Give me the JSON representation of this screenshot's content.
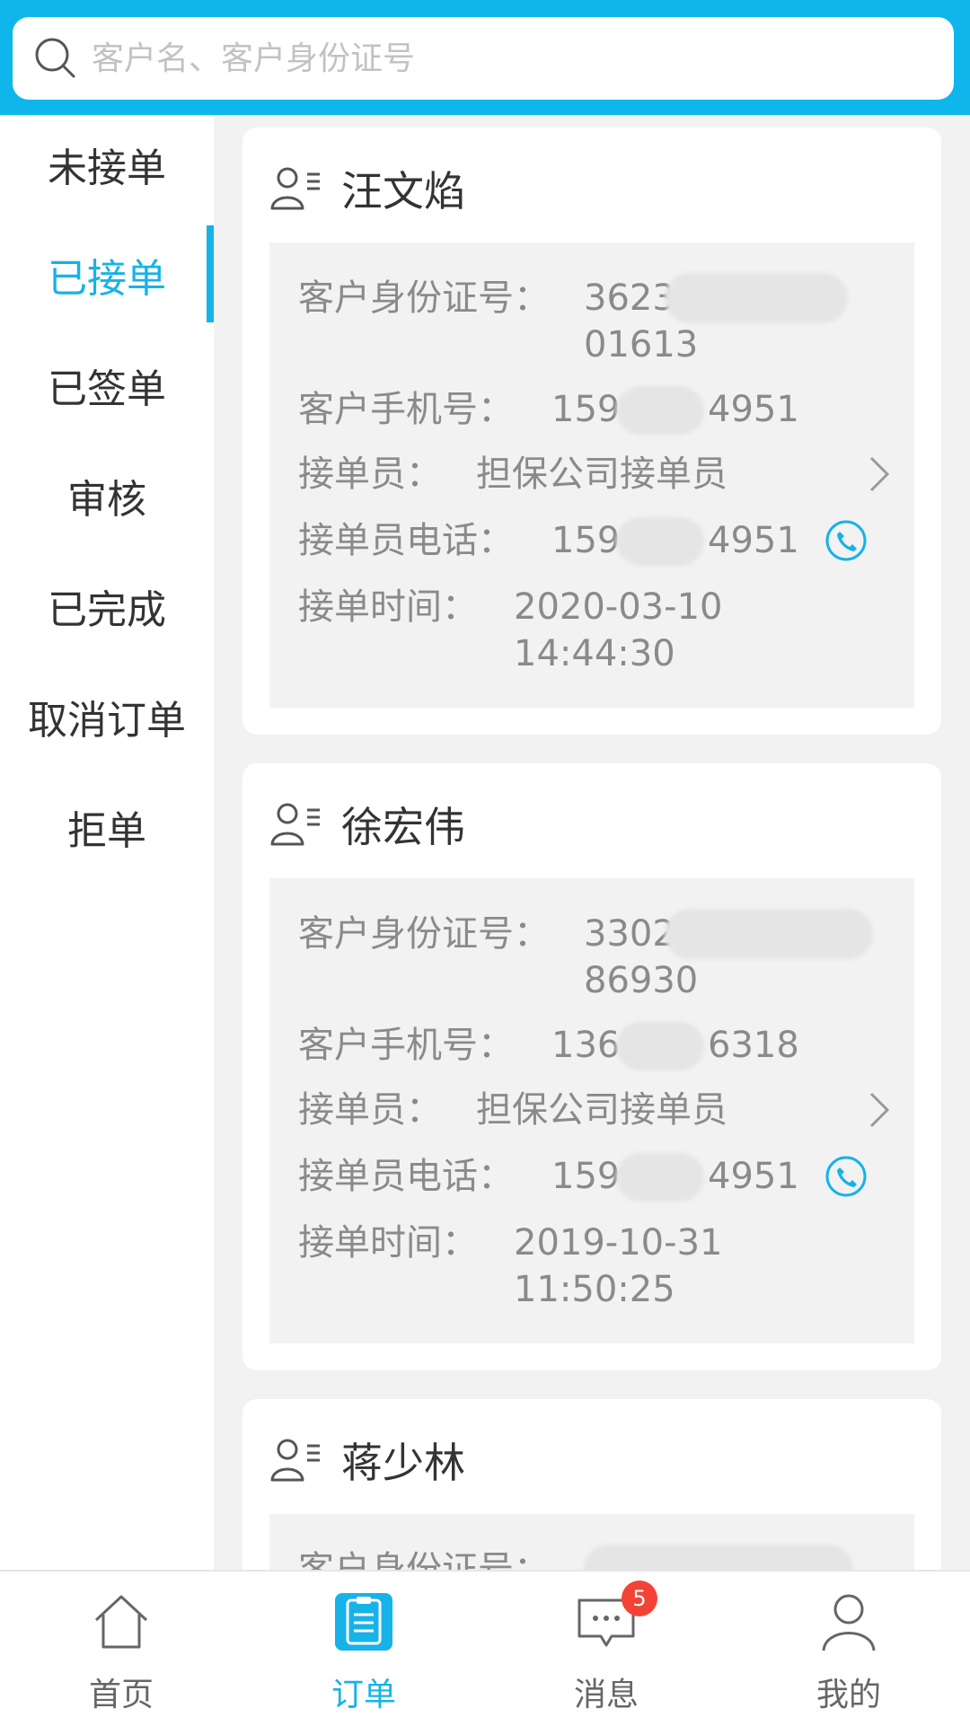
{
  "search": {
    "placeholder": "客户名、客户身份证号"
  },
  "sidebar": {
    "items": [
      {
        "label": "未接单"
      },
      {
        "label": "已接单"
      },
      {
        "label": "已签单"
      },
      {
        "label": "审核"
      },
      {
        "label": "已完成"
      },
      {
        "label": "取消订单"
      },
      {
        "label": "拒单"
      }
    ],
    "active_index": 1
  },
  "labels": {
    "id": "客户身份证号：",
    "mobile": "客户手机号：",
    "agent": "接单员：",
    "agent_phone": "接单员电话：",
    "time": "接单时间："
  },
  "orders": [
    {
      "name": "汪文焰",
      "id_line1": "3623",
      "id_line2": "01613",
      "mobile_prefix": "159",
      "mobile_suffix": "4951",
      "agent": "担保公司接单员",
      "agent_phone_prefix": "159",
      "agent_phone_suffix": "4951",
      "date": "2020-03-10",
      "time": "14:44:30"
    },
    {
      "name": "徐宏伟",
      "id_line1": "3302",
      "id_line2": "86930",
      "mobile_prefix": "136",
      "mobile_suffix": "6318",
      "agent": "担保公司接单员",
      "agent_phone_prefix": "159",
      "agent_phone_suffix": "4951",
      "date": "2019-10-31",
      "time": "11:50:25"
    },
    {
      "name": "蒋少林"
    }
  ],
  "tabbar": {
    "items": [
      {
        "label": "首页",
        "icon": "home-icon"
      },
      {
        "label": "订单",
        "icon": "order-icon"
      },
      {
        "label": "消息",
        "icon": "message-icon",
        "badge": "5"
      },
      {
        "label": "我的",
        "icon": "profile-icon"
      }
    ],
    "active_index": 1
  },
  "colors": {
    "accent": "#17b2e8",
    "header": "#0fb6ec",
    "badge": "#f44336"
  }
}
